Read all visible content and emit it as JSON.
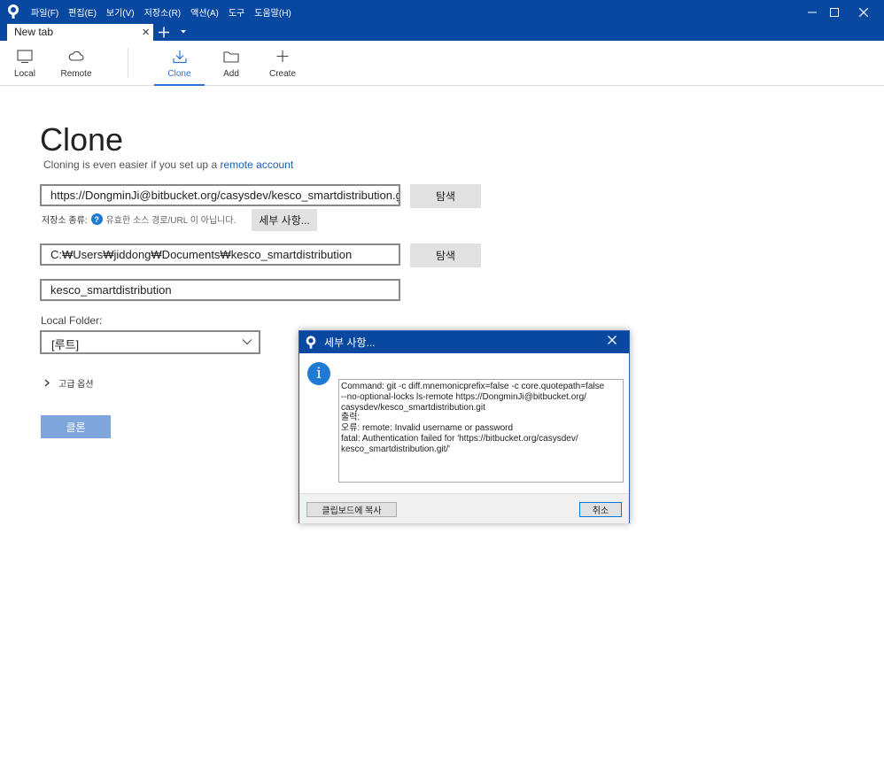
{
  "menu": [
    "파일(F)",
    "편집(E)",
    "보기(V)",
    "저장소(R)",
    "액션(A)",
    "도구",
    "도움말(H)"
  ],
  "tab": {
    "label": "New tab"
  },
  "toolbar": {
    "local": "Local",
    "remote": "Remote",
    "clone": "Clone",
    "add": "Add",
    "create": "Create"
  },
  "page": {
    "title": "Clone",
    "subtitle_prefix": "Cloning is even easier if you set up a",
    "subtitle_link": "remote account"
  },
  "form": {
    "url_value": "https://DongminJi@bitbucket.org/casysdev/kesco_smartdistribution.g",
    "browse1": "탐색",
    "repo_type_label": "저장소 종류:",
    "repo_type_msg": "유효한 소스 경로/URL 이 아닙니다.",
    "details_button": "세부 사항...",
    "path_value": "C:₩Users₩jiddong₩Documents₩kesco_smartdistribution",
    "browse2": "탐색",
    "name_value": "kesco_smartdistribution",
    "local_folder_label": "Local Folder:",
    "local_folder_value": "[루트]",
    "advanced": "고급 옵션",
    "clone_button": "클론"
  },
  "dialog": {
    "title": "세부 사항...",
    "message": [
      "Command: git -c diff.mnemonicprefix=false -c core.quotepath=false",
      "--no-optional-locks ls-remote https://DongminJi@bitbucket.org/",
      "casysdev/kesco_smartdistribution.git",
      "출력:",
      "오류: remote: Invalid username or password",
      "fatal: Authentication failed for 'https://bitbucket.org/casysdev/",
      "kesco_smartdistribution.git/'"
    ],
    "copy_button": "클립보드에 복사",
    "cancel_button": "취소"
  },
  "colors": {
    "accent": "#0948a0",
    "active": "#2a74d5",
    "clone_button": "#7fa6db"
  }
}
